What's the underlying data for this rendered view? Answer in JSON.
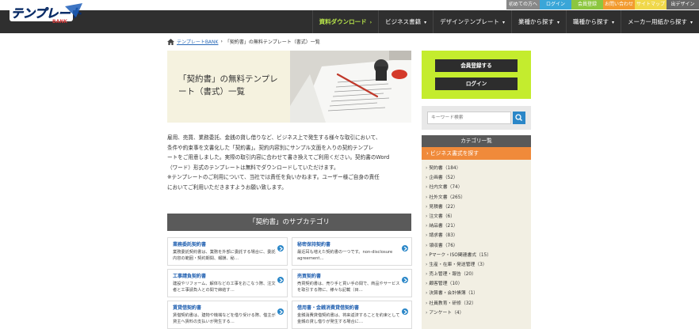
{
  "toplinks": [
    {
      "label": "初めての方へ",
      "color": "#888888",
      "width": 42
    },
    {
      "label": "ログイン",
      "color": "#3aa6d8",
      "width": 40
    },
    {
      "label": "会員登録",
      "color": "#8cc63f",
      "width": 40
    },
    {
      "label": "お問い合わせ",
      "color": "#f29b2f",
      "width": 40
    },
    {
      "label": "サイトマップ",
      "color": "#f0d84a",
      "width": 40
    },
    {
      "label": "出デザイン",
      "color": "#666666",
      "width": 41
    }
  ],
  "logo": {
    "text": "テンプレート",
    "sub": "BANK"
  },
  "nav": [
    {
      "label": "資料ダウンロード",
      "caret": "›",
      "active": true
    },
    {
      "label": "ビジネス書籍",
      "caret": "▾"
    },
    {
      "label": "デザインテンプレート",
      "caret": "▾"
    },
    {
      "label": "業種から探す",
      "caret": "▾"
    },
    {
      "label": "職種から探す",
      "caret": "▾"
    },
    {
      "label": "メーカー用紙から探す",
      "caret": "▾"
    }
  ],
  "breadcrumb": {
    "home_label": "テンプレートBANK",
    "separator": "›",
    "current": "「契約書」の無料テンプレート（書式）一覧"
  },
  "hero": {
    "title_line1": "「契約書」の無料テンプレ",
    "title_line2": "ート（書式）一覧"
  },
  "intro": [
    "雇用、売買、業務委託、金銭の貸し借りなど、ビジネス上で発生する様々な取引において、",
    "条件や約束事を文書化した「契約書」。契約内容別にサンプル文面を入りの契約テンプレ",
    "ートをご用意しました。実際の取引内容に合わせて書き換えてご利用ください。契約書のWord",
    "（ワード）形式のテンプレートは無料でダウンロードしていただけます。",
    "※テンプレートのご利用について、当社では責任を負いかねます。ユーザー様ご自身の責任",
    "においてご利用いただきますようお願い致します。"
  ],
  "subcategory": {
    "header": "「契約書」のサブカテゴリ",
    "cards": [
      {
        "title": "業務委託契約書",
        "desc": "業務委託契約書は、業務を外部に委託する場合に、委託内容の範囲・契約期間、報酬、秘…"
      },
      {
        "title": "秘密保持契約書",
        "desc": "最近耳も増えた契約書の一つです。non-disclosure agreement…"
      },
      {
        "title": "工事請負契約書",
        "desc": "建設やリフォーム、解体などの工事をおこなう際、注文者と工事請負人との間で締結す…"
      },
      {
        "title": "売買契約書",
        "desc": "売買契約書は、売り手と買い手の間で、商品やサービスを取引する際に、様々な記載（目…"
      },
      {
        "title": "賃貸借契約書",
        "desc": "賃借契約書は、建物や機械などを借り受ける際、借主が貸主へ賃料の支払いが発生する…"
      },
      {
        "title": "借用書・金銭消費貸借契約書",
        "desc": "金銭消費貸借契約書は、将来返済することを約束として金銭の貸し借りが発生する場合に…"
      }
    ]
  },
  "sidebar": {
    "signup_label": "会員登録する",
    "login_label": "ログイン",
    "search_placeholder": "キーワード検索",
    "category_header": "カテゴリ一覧",
    "category_sub": "ビジネス書式を探す",
    "categories": [
      "契約書（184）",
      "企画書（52）",
      "社内文書（74）",
      "社外文書（265）",
      "見積書（22）",
      "注文書（6）",
      "納品書（21）",
      "請求書（83）",
      "領収書（76）",
      "Pマーク・ISO関連書式（15）",
      "生産・在庫・発送管理（3）",
      "売上管理・報告（20）",
      "顧客管理（10）",
      "決算書・会計帳簿（1）",
      "社員教育・研修（32）",
      "アンケート（4）"
    ]
  },
  "colors": {
    "nav_bg": "#2f2f2f",
    "accent_green": "#c4ec2e",
    "accent_orange": "#f08a3a",
    "link_blue": "#2a6ab8"
  }
}
